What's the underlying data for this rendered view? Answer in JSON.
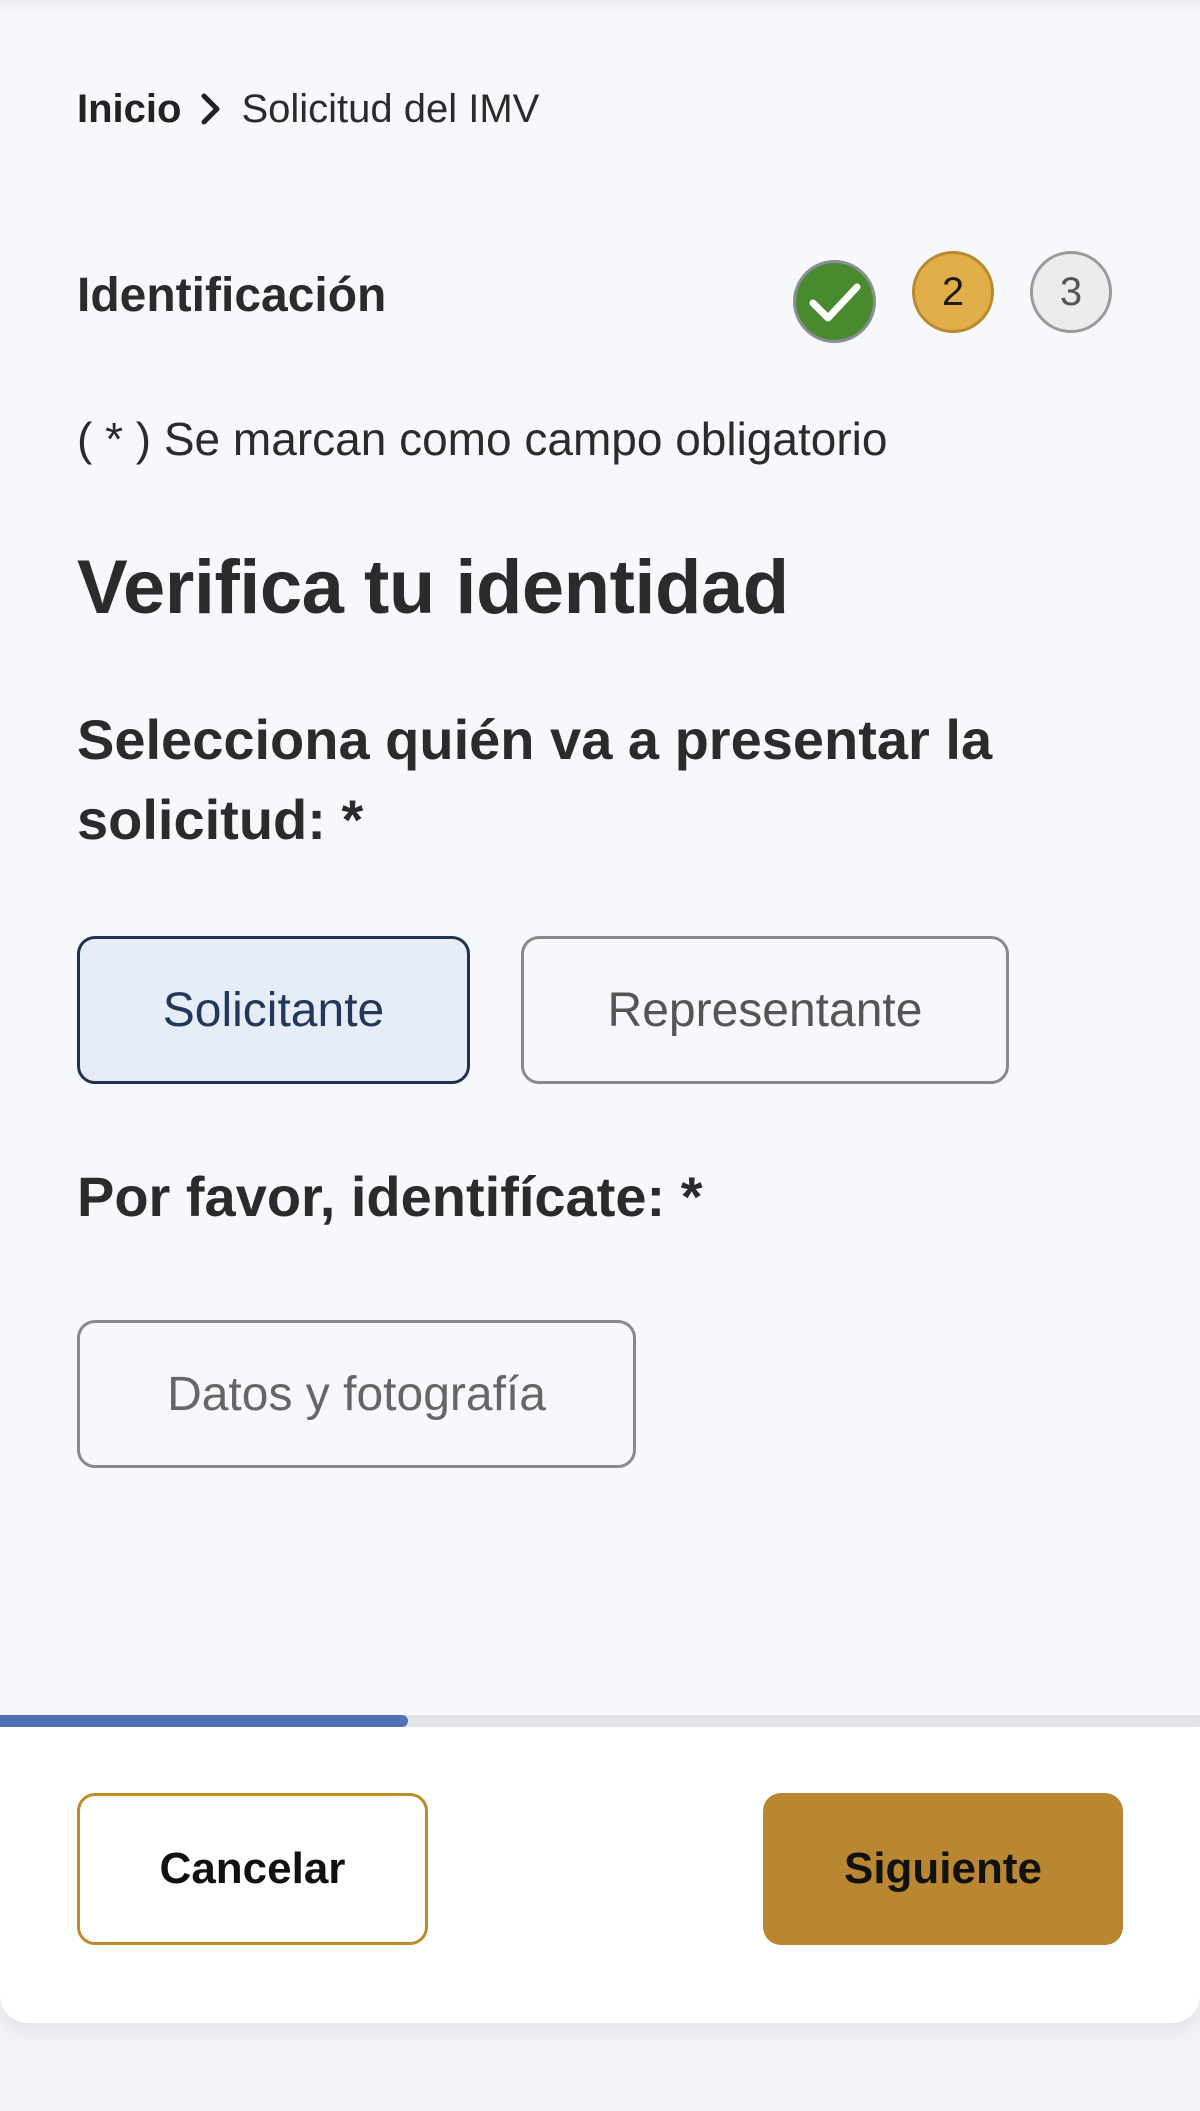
{
  "breadcrumb": {
    "home": "Inicio",
    "separator_icon": "chevron-right-icon",
    "current": "Solicitud del IMV"
  },
  "stepper": {
    "title": "Identificación",
    "steps": [
      {
        "label": "",
        "state": "completed",
        "icon": "check-icon",
        "color": "#4a8a2f"
      },
      {
        "label": "2",
        "state": "current",
        "color": "#e1ae4a"
      },
      {
        "label": "3",
        "state": "pending",
        "color": "#ececec"
      }
    ]
  },
  "form": {
    "required_note": "( * ) Se marcan como campo obligatorio",
    "title": "Verifica tu identidad",
    "presenter_question": "Selecciona quién va a presentar la solicitud: *",
    "presenter_options": [
      {
        "label": "Solicitante",
        "selected": true
      },
      {
        "label": "Representante",
        "selected": false
      }
    ],
    "identify_label": "Por favor, identifícate: *",
    "identify_option": "Datos y fotografía"
  },
  "progress": {
    "value": 0.34,
    "color": "#4f72b4"
  },
  "footer": {
    "cancel_label": "Cancelar",
    "next_label": "Siguiente",
    "accent_color": "#b98731"
  }
}
